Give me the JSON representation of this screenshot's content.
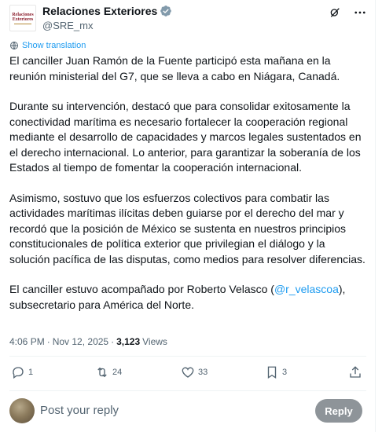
{
  "account": {
    "display_name": "Relaciones Exteriores",
    "handle": "@SRE_mx",
    "logo_line1": "Relaciones",
    "logo_line2": "Exteriores"
  },
  "header_icons": [
    "grok-icon",
    "more-icon"
  ],
  "translate_label": "Show translation",
  "tweet": {
    "p1": "El canciller Juan Ramón de la Fuente participó esta mañana en la reunión ministerial del G7, que se lleva a cabo en Niágara, Canadá.",
    "p2": "Durante su intervención, destacó que para consolidar  exitosamente la conectividad marítima es necesario fortalecer la cooperación regional mediante el desarrollo de capacidades y marcos legales sustentados en el derecho internacional. Lo anterior, para garantizar la soberanía de los Estados al tiempo de fomentar la cooperación internacional.",
    "p3": "Asimismo, sostuvo que los esfuerzos colectivos para combatir las actividades marítimas ilícitas deben guiarse por el derecho del mar y recordó que la posición de México se sustenta en nuestros principios constitucionales de política exterior que privilegian el diálogo y la solución pacífica de las disputas, como medios para resolver diferencias.",
    "p4_before": "El canciller estuvo acompañado por Roberto Velasco (",
    "p4_mention": "@r_velascoa",
    "p4_after": "), subsecretario para América del Norte."
  },
  "meta": {
    "time": "4:06 PM",
    "separator": "·",
    "date": "Nov 12, 2025",
    "views_count": "3,123",
    "views_label": "Views"
  },
  "actions": {
    "replies": "1",
    "reposts": "24",
    "likes": "33",
    "bookmarks": "3"
  },
  "reply": {
    "placeholder": "Post your reply",
    "button_label": "Reply"
  },
  "colors": {
    "accent": "#1d9bf0",
    "muted": "#536471",
    "text": "#0f1419",
    "reply_button": "#8e9499"
  }
}
